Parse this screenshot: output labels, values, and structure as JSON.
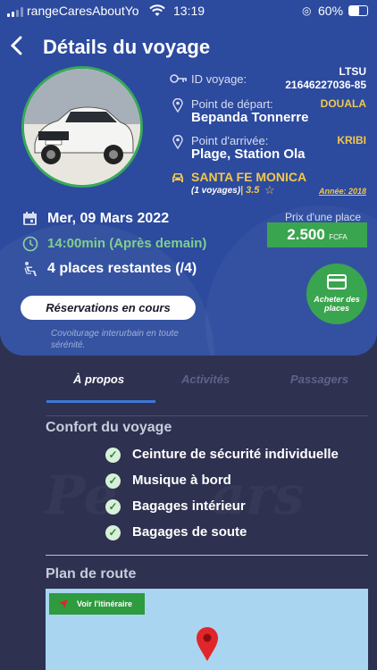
{
  "status_bar": {
    "carrier": "rangeCaresAboutYo",
    "time": "13:19",
    "battery": "60%"
  },
  "header": {
    "title": "Détails du voyage"
  },
  "trip": {
    "id_label": "ID voyage:",
    "id_value_1": "LTSU",
    "id_value_2": "21646227036-85",
    "departure_label": "Point de départ:",
    "departure_city": "DOUALA",
    "departure_place": "Bepanda Tonnerre",
    "arrival_label": "Point d'arrivée:",
    "arrival_city": "KRIBI",
    "arrival_place": "Plage, Station Ola",
    "car_model": "SANTA FE MONICA",
    "car_trips": "(1 voyages)",
    "car_rating": "| 3.5",
    "car_year": "Année: 2018",
    "date": "Mer, 09 Mars 2022",
    "time": "14:00min (Après demain)",
    "seats": "4 places restantes (/4)",
    "price_label": "Prix d'une place",
    "price_value": "2.500",
    "price_currency": "FCFA",
    "buy_label_1": "Acheter des",
    "buy_label_2": "places",
    "reservations_button": "Réservations en cours",
    "tagline_1": "Covoiturage interurbain en toute",
    "tagline_2": "sérénité."
  },
  "tabs": [
    {
      "label": "À propos",
      "active": true
    },
    {
      "label": "Activités",
      "active": false
    },
    {
      "label": "Passagers",
      "active": false
    }
  ],
  "comfort": {
    "title": "Confort du voyage",
    "items": [
      "Ceinture de sécurité individuelle",
      "Musique à bord",
      "Bagages intérieur",
      "Bagages de soute"
    ]
  },
  "route": {
    "title": "Plan de route",
    "button": "Voir l'itinéraire"
  },
  "colors": {
    "card": "#2c4a9e",
    "background": "#2e3150",
    "accent_green": "#3aa54f",
    "accent_yellow": "#f3c74a"
  }
}
